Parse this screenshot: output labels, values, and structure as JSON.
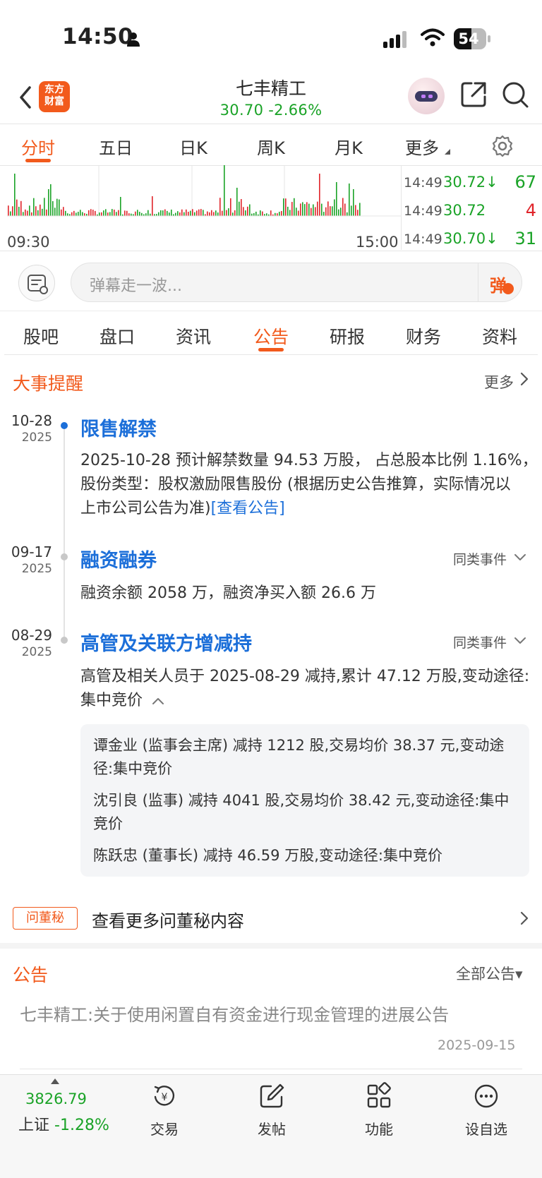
{
  "status_bar": {
    "time": "14:50",
    "battery": "54"
  },
  "header": {
    "logo_line1": "东方",
    "logo_line2": "财富",
    "stock_name": "七丰精工",
    "price": "30.70",
    "change": "-2.66%"
  },
  "chart_tabs": [
    "分时",
    "五日",
    "日K",
    "周K",
    "月K",
    "更多"
  ],
  "chart_data": {
    "type": "bar",
    "x_range": [
      "09:30",
      "15:00"
    ],
    "volume_bars_note": "",
    "ticks": [
      {
        "time": "14:49",
        "price": "30.72",
        "arrow": "↓",
        "volume": "67",
        "color": "#1aa327"
      },
      {
        "time": "14:49",
        "price": "30.72",
        "arrow": "",
        "volume": "4",
        "color": "#e0242a"
      },
      {
        "time": "14:49",
        "price": "30.70",
        "arrow": "↓",
        "volume": "31",
        "color": "#1aa327"
      }
    ],
    "colors": {
      "up": "#e0242a",
      "down": "#1aa327"
    }
  },
  "danmu": {
    "placeholder": "弹幕走一波...",
    "send_label": "弹"
  },
  "section_tabs": [
    "股吧",
    "盘口",
    "资讯",
    "公告",
    "研报",
    "财务",
    "资料"
  ],
  "events": {
    "title": "大事提醒",
    "more_label": "更多",
    "items": [
      {
        "date": "10-28",
        "year": "2025",
        "title": "限售解禁",
        "body_line1": "2025-10-28 预计解禁数量 94.53 万股， 占总股本比例 1.16%，",
        "body_line2": "股份类型：股权激励限售股份 (根据历史公告推算，实际情况以",
        "body_line3": "上市公司公告为准)",
        "link": "[查看公告]"
      },
      {
        "date": "09-17",
        "year": "2025",
        "title": "融资融券",
        "same_event": "同类事件",
        "body_line1": "融资余额 2058 万，融资净买入额 26.6 万"
      },
      {
        "date": "08-29",
        "year": "2025",
        "title": "高管及关联方增减持",
        "same_event": "同类事件",
        "body_line1": "高管及相关人员于 2025-08-29 减持,累计 47.12 万股,变动途径:",
        "body_line2": "集中竞价",
        "details": [
          {
            "line1": "谭金业 (监事会主席) 减持 1212 股,交易均价 38.37 元,变动途",
            "line2": "径:集中竞价"
          },
          {
            "line1": "沈引良 (监事) 减持 4041 股,交易均价 38.42 元,变动途径:集中",
            "line2": "竞价"
          },
          {
            "line1": "陈跃忠 (董事长) 减持 46.59 万股,变动途径:集中竞价",
            "line2": ""
          }
        ]
      }
    ]
  },
  "dongmi": {
    "badge": "问董秘",
    "text": "查看更多问董秘内容"
  },
  "notices": {
    "title": "公告",
    "filter_label": "全部公告▾",
    "items": [
      {
        "title": "七丰精工:关于使用闲置自有资金进行现金管理的进展公告",
        "date": "2025-09-15"
      }
    ]
  },
  "bottom_bar": {
    "index_value": "3826.79",
    "index_name": "上证",
    "index_change": "-1.28%",
    "nav": [
      "交易",
      "发帖",
      "功能",
      "设自选"
    ]
  }
}
